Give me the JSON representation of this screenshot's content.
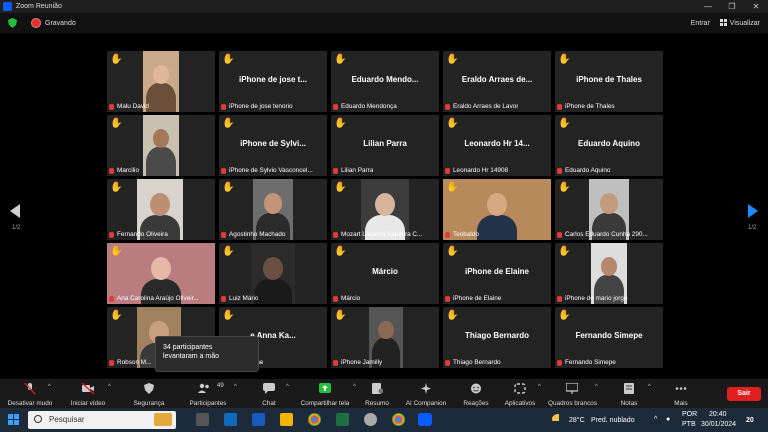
{
  "window": {
    "title": "Zoom Reunião",
    "buttons": [
      "—",
      "❐",
      "✕"
    ]
  },
  "topbar": {
    "recording": "Gravando",
    "enter": "Entrar",
    "view": "Visualizar"
  },
  "pages": {
    "left": "1/2",
    "right": "1/2"
  },
  "tiles": [
    {
      "center": "",
      "label": "Malu David",
      "video": "woman-glasses"
    },
    {
      "center": "iPhone de jose t...",
      "label": "iPhone de jose tenorio"
    },
    {
      "center": "Eduardo Mendo...",
      "label": "Eduardo Mendonça"
    },
    {
      "center": "Eraldo Arraes de...",
      "label": "Eraldo Arraes de Lavor"
    },
    {
      "center": "iPhone de Thales",
      "label": "iPhone de Thales"
    },
    {
      "center": "",
      "label": "Marcilio",
      "video": "man-dark"
    },
    {
      "center": "iPhone de Sylvi...",
      "label": "iPhone de Sylvio Vasconcel..."
    },
    {
      "center": "Lilian Parra",
      "label": "Lilian Parra"
    },
    {
      "center": "Leonardo Hr 14...",
      "label": "Leonardo Hr 14908"
    },
    {
      "center": "Eduardo Aquino",
      "label": "Eduardo Aquino"
    },
    {
      "center": "",
      "label": "Fernando Oliveira",
      "video": "man-gray"
    },
    {
      "center": "",
      "label": "Agostinho Machado",
      "video": "man-hand"
    },
    {
      "center": "",
      "label": "Mozart Lacerda Siqueira C...",
      "video": "man-white"
    },
    {
      "center": "",
      "label": "Teobaldo",
      "video": "man-wave"
    },
    {
      "center": "",
      "label": "Carlos Eduardo Cunha 290...",
      "video": "man-old"
    },
    {
      "center": "",
      "label": "Ana Carolina Araújo Oliveir...",
      "video": "woman-pink"
    },
    {
      "center": "",
      "label": "Luiz Mário",
      "video": "dark-room"
    },
    {
      "center": "Márcio",
      "label": "Márcio"
    },
    {
      "center": "iPhone de Elaine",
      "label": "iPhone de Elaine"
    },
    {
      "center": "",
      "label": "iPhone de mario jorge",
      "video": "man-glasses"
    },
    {
      "center": "",
      "label": "Robson M...",
      "video": "man-room"
    },
    {
      "center": "e Anna Ka...",
      "label": "nna Karinne"
    },
    {
      "center": "",
      "label": "iPhone Jamilly",
      "video": "person-dark"
    },
    {
      "center": "Thiago Bernardo",
      "label": "Thiago Bernardo"
    },
    {
      "center": "Fernando Simepe",
      "label": "Fernando Simepe"
    }
  ],
  "popup": {
    "line1": "34 participantes",
    "line2": "levantaram a mão"
  },
  "toolbar": {
    "mute": "Desativar mudo",
    "video": "Iniciar vídeo",
    "security": "Segurança",
    "participants": "Participantes",
    "participants_count": "49",
    "chat": "Chat",
    "share": "Compartilhar tela",
    "summary": "Resumo",
    "companion": "AI Companion",
    "reactions": "Reações",
    "apps": "Aplicativos",
    "whiteboards": "Quadros brancos",
    "notes": "Notas",
    "more": "Mais",
    "leave": "Sair"
  },
  "taskbar": {
    "search_placeholder": "Pesquisar",
    "weather": "28°C",
    "weather_desc": "Pred. nublado",
    "lang1": "POR",
    "lang2": "PTB",
    "time": "20:40",
    "date": "30/01/2024",
    "notif": "20"
  },
  "colors": {
    "accent": "#1a8cff",
    "hand": "#f3c11b",
    "leave": "#e02020",
    "share": "#21c13b"
  }
}
